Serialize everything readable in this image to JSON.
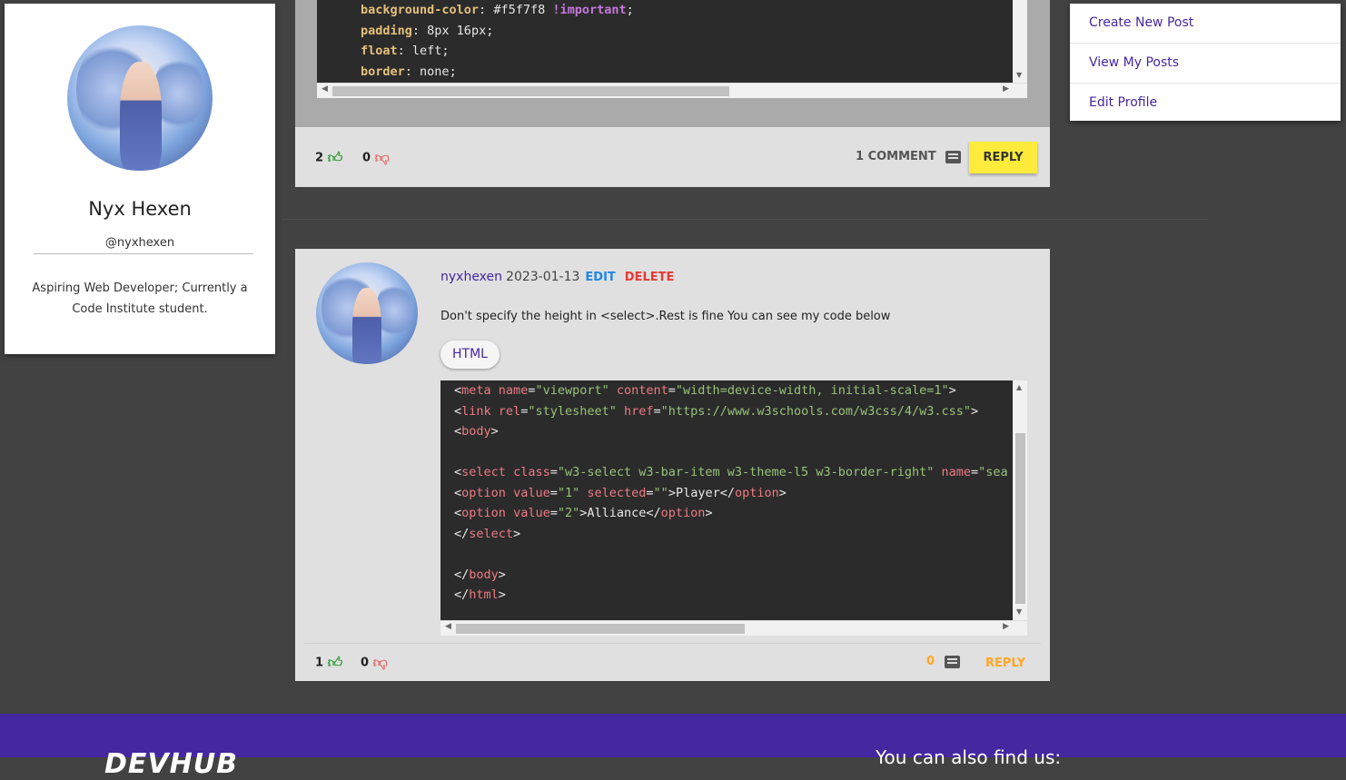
{
  "profile": {
    "name": "Nyx Hexen",
    "handle": "@nyxhexen",
    "bio": "Aspiring Web Developer; Currently a Code Institute student."
  },
  "menu": {
    "items": [
      "Create New Post",
      "View My Posts",
      "Edit Profile"
    ]
  },
  "post1": {
    "code_lines": [
      {
        "prop": "background-color",
        "value": "#f5f7f8",
        "important": "!important",
        "end": ";"
      },
      {
        "prop": "padding",
        "value": "8px 16px",
        "important": "",
        "end": ";"
      },
      {
        "prop": "float",
        "value": "left",
        "important": "",
        "end": ";"
      },
      {
        "prop": "border",
        "value": "none",
        "important": "",
        "end": ";"
      }
    ],
    "likes": "2",
    "dislikes": "0",
    "comment_label": "1 COMMENT",
    "reply_label": "REPLY"
  },
  "post2": {
    "username": "nyxhexen",
    "date": "2023-01-13",
    "edit_label": "EDIT",
    "delete_label": "DELETE",
    "text": "Don't specify the height in <select>.Rest is fine You can see my code below",
    "language": "HTML",
    "likes": "1",
    "dislikes": "0",
    "comment_count": "0",
    "reply_label": "REPLY"
  },
  "footer": {
    "logo": "DEVHUB",
    "find_us": "You can also find us:"
  },
  "colors": {
    "background": "#424242",
    "accent": "#4527a0",
    "reply_yellow": "#ffeb3b",
    "reply_orange": "#ffa726",
    "like_green": "#43a047",
    "dislike_red": "#e57373"
  }
}
